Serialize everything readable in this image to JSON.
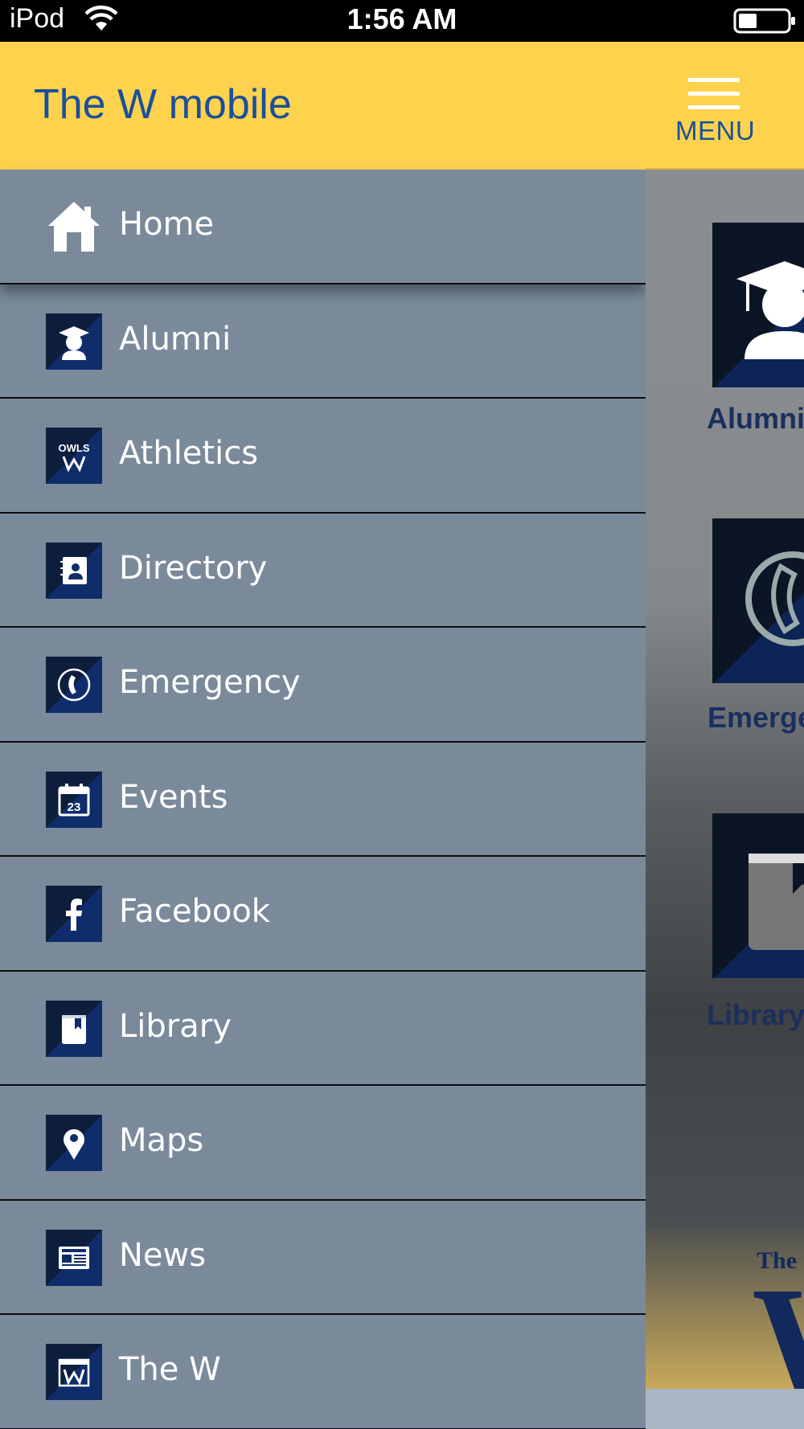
{
  "status_bar": {
    "carrier": "iPod",
    "time": "1:56 AM"
  },
  "header": {
    "title": "The W mobile",
    "menu_label": "MENU"
  },
  "menu": {
    "items": [
      {
        "label": "Home",
        "icon": "home-icon"
      },
      {
        "label": "Alumni",
        "icon": "graduate-icon"
      },
      {
        "label": "Athletics",
        "icon": "owls-logo-icon"
      },
      {
        "label": "Directory",
        "icon": "contact-book-icon"
      },
      {
        "label": "Emergency",
        "icon": "phone-icon"
      },
      {
        "label": "Events",
        "icon": "calendar-icon"
      },
      {
        "label": "Facebook",
        "icon": "facebook-icon"
      },
      {
        "label": "Library",
        "icon": "book-icon"
      },
      {
        "label": "Maps",
        "icon": "map-pin-icon"
      },
      {
        "label": "News",
        "icon": "newspaper-icon"
      },
      {
        "label": "The W",
        "icon": "the-w-icon"
      }
    ],
    "calendar_day": "23",
    "owls_text": "OWLS"
  },
  "background_tiles": [
    {
      "label": "Alumni",
      "icon": "graduate-icon"
    },
    {
      "label": "Emergency",
      "icon": "phone-icon"
    },
    {
      "label": "Library",
      "icon": "book-icon"
    }
  ],
  "background_logo": {
    "the": "The",
    "w": "W"
  },
  "colors": {
    "header": "#fdd24d",
    "brand_blue": "#1a4f9c",
    "drawer_bg": "#7a8a9b",
    "icon_navy": "#0f2d6a"
  }
}
